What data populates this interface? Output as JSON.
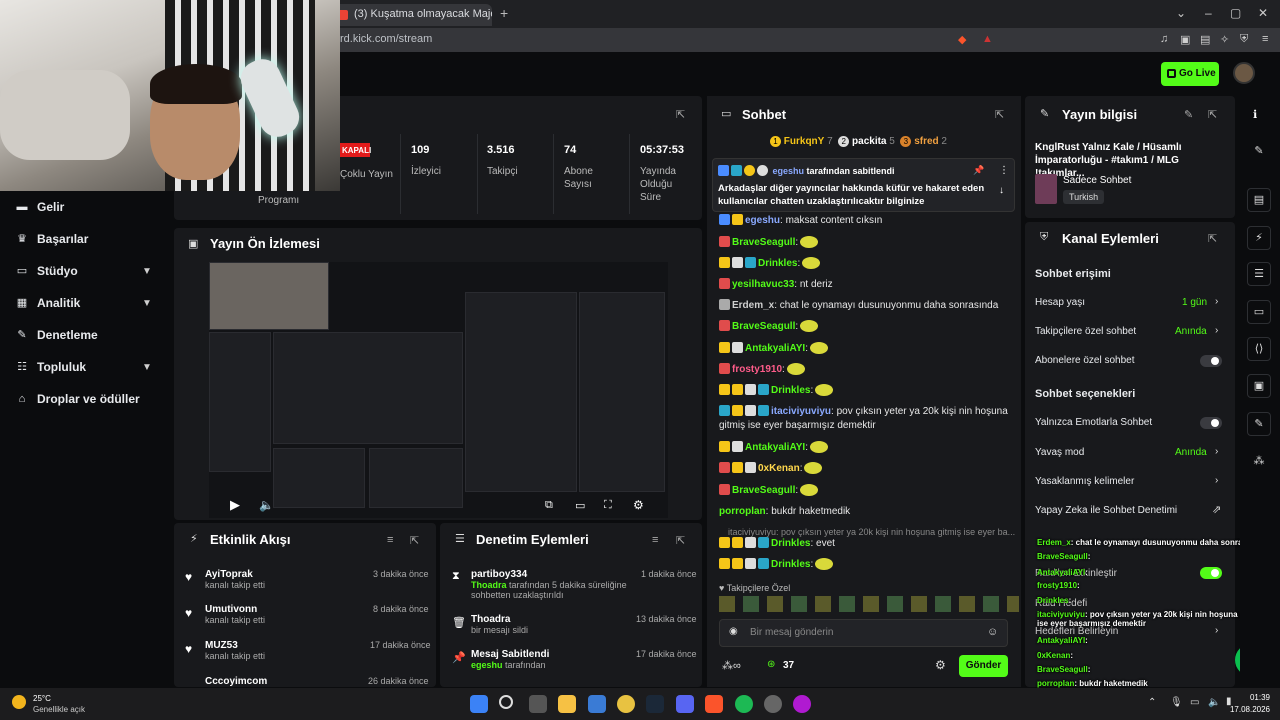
{
  "browser": {
    "tab_title": "(3) Kuşatma olmayacak Majesteleri...",
    "url": "rd.kick.com/stream",
    "new_tab": "+"
  },
  "header": {
    "go_live": "Go Live"
  },
  "sidebar": {
    "items": [
      {
        "label": "Gelir",
        "icon": "wallet-icon"
      },
      {
        "label": "Başarılar",
        "icon": "trophy-icon"
      },
      {
        "label": "Stüdyo",
        "icon": "studio-icon"
      },
      {
        "label": "Analitik",
        "icon": "analytics-icon"
      },
      {
        "label": "Denetleme",
        "icon": "wrench-icon"
      },
      {
        "label": "Topluluk",
        "icon": "community-icon"
      },
      {
        "label": "Droplar ve ödüller",
        "icon": "gift-icon"
      }
    ]
  },
  "stats": {
    "status": "KAPALI",
    "status_label": "Çoklu Yayın",
    "program_label": "Programı",
    "viewers_value": "109",
    "viewers_label": "İzleyici",
    "followers_value": "3.516",
    "followers_label": "Takipçi",
    "subs_value": "74",
    "subs_label1": "Abone",
    "subs_label2": "Sayısı",
    "time_value": "05:37:53",
    "time_label1": "Yayında",
    "time_label2": "Olduğu",
    "time_label3": "Süre"
  },
  "preview": {
    "title": "Yayın Ön İzlemesi"
  },
  "activity": {
    "title": "Etkinlik Akışı",
    "items": [
      {
        "name": "AyiToprak",
        "action": "kanalı takip etti",
        "time": "3 dakika önce"
      },
      {
        "name": "Umutivonn",
        "action": "kanalı takip etti",
        "time": "8 dakika önce"
      },
      {
        "name": "MUZ53",
        "action": "kanalı takip etti",
        "time": "17 dakika önce"
      },
      {
        "name": "Cccoyimcom",
        "action": "",
        "time": "26 dakika önce"
      }
    ]
  },
  "modlog": {
    "title": "Denetim Eylemleri",
    "items": [
      {
        "name": "partiboy334",
        "detail_user": "Thoadra",
        "detail": " tarafından 5 dakika süreliğine sohbetten uzaklaştırıldı",
        "time": "1 dakika önce"
      },
      {
        "name": "Thoadra",
        "detail_user": "",
        "detail": "bir mesajı sildi",
        "time": "13 dakika önce"
      },
      {
        "name": "Mesaj Sabitlendi",
        "detail_user": "egeshu",
        "detail": " tarafından",
        "time": "17 dakika önce"
      }
    ]
  },
  "chat": {
    "title": "Sohbet",
    "top": [
      {
        "rank": "1",
        "name": "FurkqnY",
        "count": "7"
      },
      {
        "rank": "2",
        "name": "packita",
        "count": "5"
      },
      {
        "rank": "3",
        "name": "sfred",
        "count": "2"
      }
    ],
    "pinned_by": "egeshu",
    "pinned_label": " tarafından sabitlendi",
    "pinned_text": "Arkadaşlar diğer yayıncılar hakkında küfür ve hakaret eden kullanıcılar chatten uzaklaştırılıcaktır bilginize",
    "messages": [
      {
        "user": "egeshu",
        "text": ": maksat content cıksın",
        "color": "#8aa9ff"
      },
      {
        "user": "BraveSeagull",
        "text": ":",
        "color": "#53fc18"
      },
      {
        "user": "Drinkles",
        "text": ":",
        "color": "#53fc18"
      },
      {
        "user": "yesilhavuc33",
        "text": ": nt deriz",
        "color": "#53fc18"
      },
      {
        "user": "Erdem_x",
        "text": ": chat le oynamayı dusunuyonmu daha sonrasında",
        "color": "#cfcfcf"
      },
      {
        "user": "BraveSeagull",
        "text": ":",
        "color": "#53fc18"
      },
      {
        "user": "AntakyaliAYI",
        "text": ":",
        "color": "#53fc18"
      },
      {
        "user": "frosty1910",
        "text": ":",
        "color": "#ff5c8a"
      },
      {
        "user": "Drinkles",
        "text": ":",
        "color": "#53fc18"
      },
      {
        "user": "itaciviyuviyu",
        "text": ": pov çıksın yeter ya 20k kişi nin hoşuna gitmiş ise eyer başarmışız demektir",
        "color": "#8aa9ff"
      },
      {
        "user": "AntakyaliAYI",
        "text": ":",
        "color": "#53fc18"
      },
      {
        "user": "0xKenan",
        "text": ":",
        "color": "#ffd84d"
      },
      {
        "user": "BraveSeagull",
        "text": ":",
        "color": "#53fc18"
      },
      {
        "user": "porroplan",
        "text": ": bukdr haketmedik",
        "color": "#53fc18"
      },
      {
        "user": "Drinkles",
        "text": ": evet",
        "color": "#53fc18"
      },
      {
        "user": "Drinkles",
        "text": ":",
        "color": "#53fc18"
      }
    ],
    "reply_preview": "itaciviyuviyu: pov çıksın yeter ya 20k kişi nin hoşuna gitmiş ise eyer ba...",
    "followers_only": "Takipçilere Özel",
    "input_placeholder": "Bir mesaj gönderin",
    "points": "37",
    "send": "Gönder"
  },
  "info": {
    "title": "Yayın bilgisi",
    "stream_title": "KnglRust Yalnız Kale / Hüsamlı İmparatorluğu - #takım1 / MLG !takımlar...",
    "category": "Sadece Sohbet",
    "language": "Turkish"
  },
  "actions": {
    "title": "Kanal Eylemleri",
    "chat_access": "Sohbet erişimi",
    "account_age": "Hesap yaşı",
    "account_age_value": "1 gün",
    "followers_only": "Takipçilere özel sohbet",
    "followers_only_value": "Anında",
    "subs_only": "Abonelere özel sohbet",
    "chat_options": "Sohbet seçenekleri",
    "emote_only": "Yalnızca Emotlarla Sohbet",
    "slow_mode": "Yavaş mod",
    "slow_mode_value": "Anında",
    "banned_words": "Yasaklanmış kelimeler",
    "ai_moderation": "Yapay Zeka ile Sohbet Denetimi",
    "raids": "Raid'leri Etkinleştir",
    "raid_label": "Raid Hedefi",
    "raid_targets": "Hedefleri Belirleyin"
  },
  "overlay": {
    "lines": [
      {
        "user": "Erdem_x",
        "text": ": chat le oynamayı dusunuyonmu daha sonrasında"
      },
      {
        "user": "BraveSeagull",
        "text": ":"
      },
      {
        "user": "AntakyaliAYI",
        "text": ":"
      },
      {
        "user": "frosty1910",
        "text": ":"
      },
      {
        "user": "Drinkles",
        "text": ":"
      },
      {
        "user": "itaciviyuviyu",
        "text": ": pov çıksın yeter ya 20k kişi nin hoşuna gitmiş ise eyer başarmışız demektir"
      },
      {
        "user": "AntakyaliAYI",
        "text": ":"
      },
      {
        "user": "0xKenan",
        "text": ":"
      },
      {
        "user": "BraveSeagull",
        "text": ":"
      },
      {
        "user": "porroplan",
        "text": ": bukdr haketmedik"
      },
      {
        "user": "Drinkles",
        "text": ": evet"
      },
      {
        "user": "Drinkles",
        "text": ":"
      }
    ]
  },
  "taskbar": {
    "temp": "25°C",
    "weather": "Genellikle açık",
    "time": "01:39",
    "date": "17.08.2026"
  },
  "colors": {
    "accent": "#53fc18",
    "panel": "#18191c",
    "bg": "#0b0c0e",
    "live_red": "#e21b1b"
  }
}
